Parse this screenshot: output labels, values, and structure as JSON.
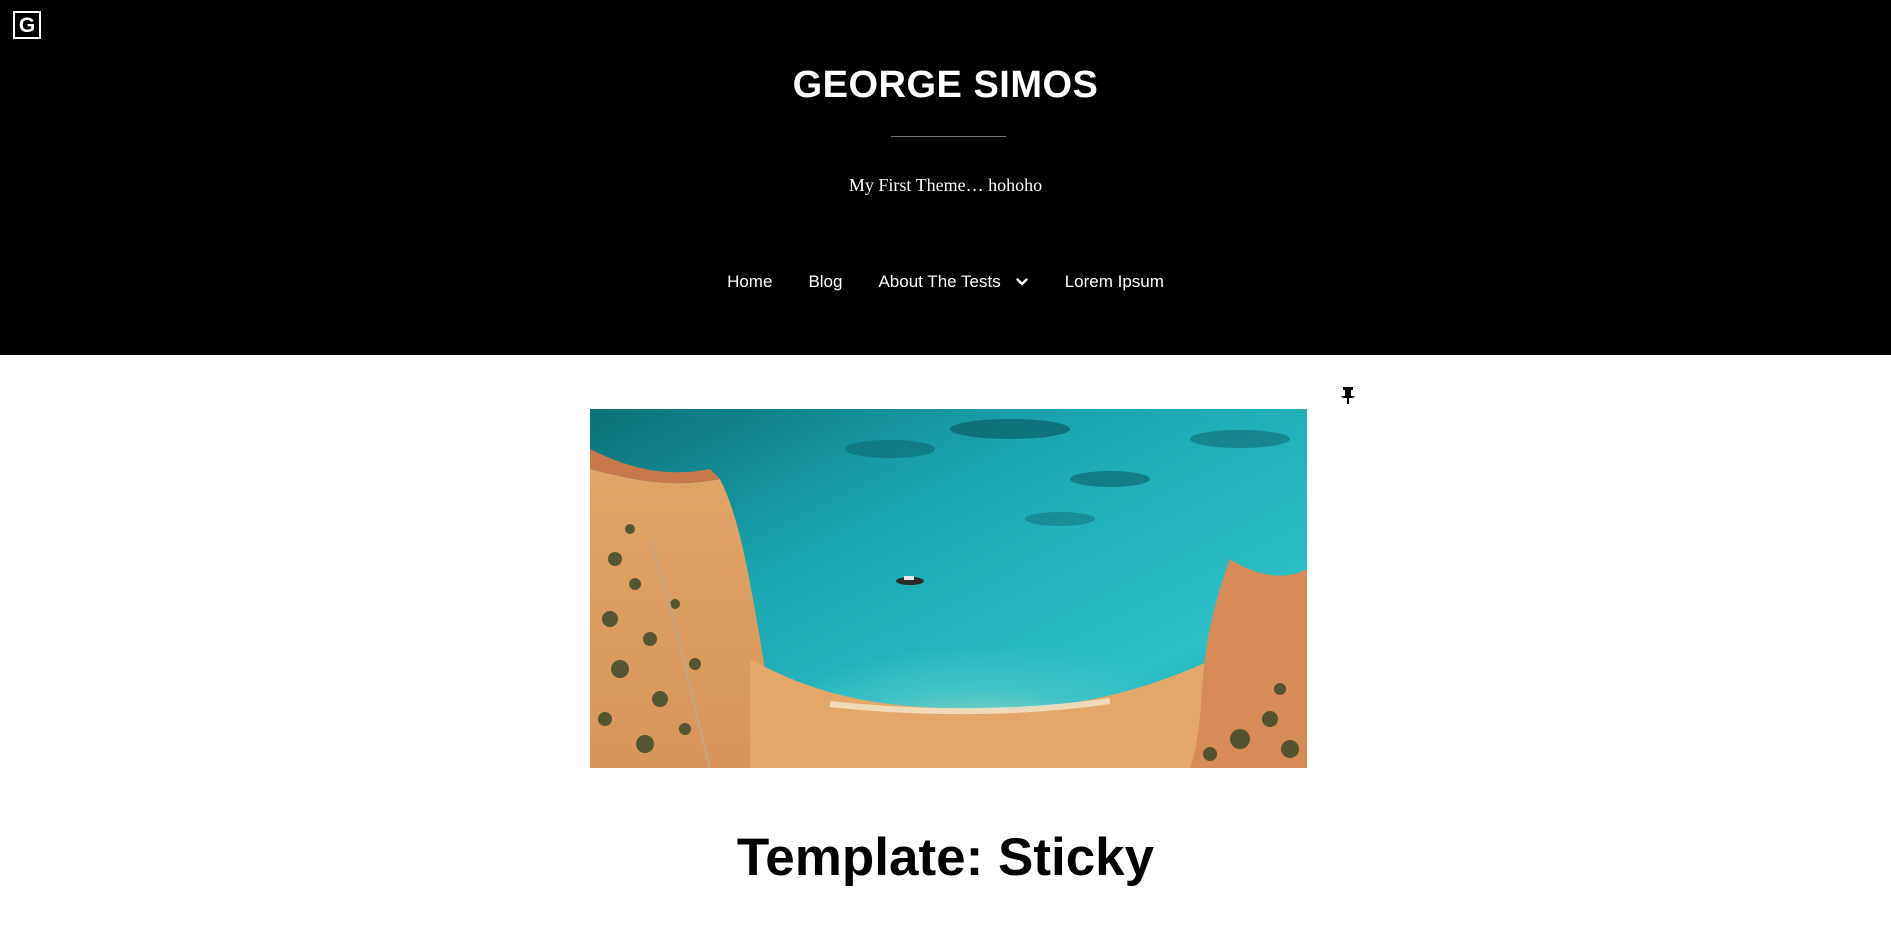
{
  "header": {
    "logo_letter": "G",
    "site_title": "GEORGE SIMOS",
    "tagline": "My First Theme… hohoho",
    "background": "#000000",
    "text_color": "#ffffff"
  },
  "nav": {
    "items": [
      {
        "label": "Home",
        "has_submenu": false
      },
      {
        "label": "Blog",
        "has_submenu": false
      },
      {
        "label": "About The Tests",
        "has_submenu": true,
        "submenu_icon": "chevron-down-icon"
      },
      {
        "label": "Lorem Ipsum",
        "has_submenu": false
      }
    ]
  },
  "post": {
    "sticky_icon": "pushpin-icon",
    "featured_image": "aerial view of turquoise bay with sandy beach and a small boat",
    "title": "Template: Sticky"
  }
}
